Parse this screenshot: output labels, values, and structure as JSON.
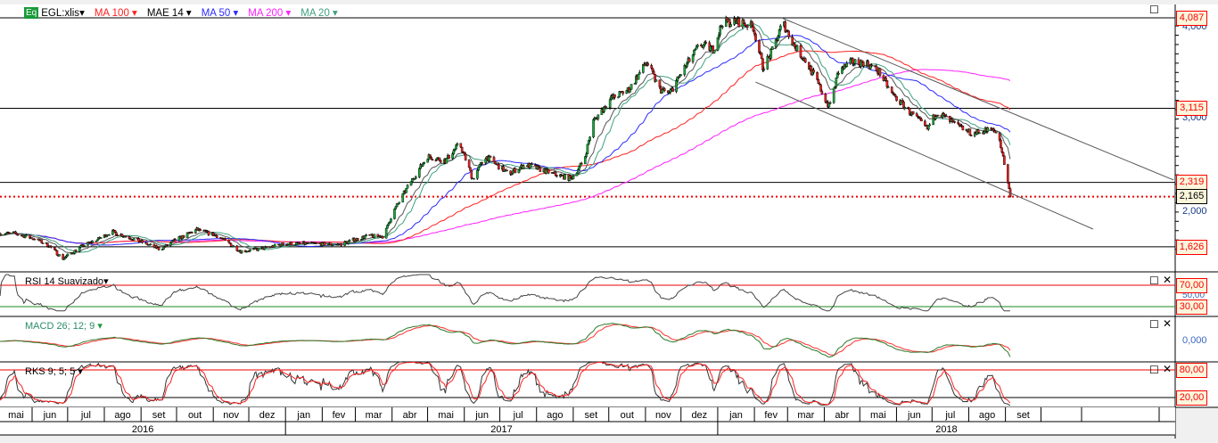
{
  "legend": {
    "symbol_badge": "Eq",
    "symbol": "EGL:xlis",
    "items": [
      {
        "label": "MA 100",
        "color": "#ff2020"
      },
      {
        "label": "MAE 14",
        "color": "#000000"
      },
      {
        "label": "MA 50",
        "color": "#2a2aff"
      },
      {
        "label": "MA 200",
        "color": "#ff20ff"
      },
      {
        "label": "MA 20",
        "color": "#40a080"
      }
    ]
  },
  "panels": {
    "rsi": "RSI 14 Suavizado",
    "macd": "MACD 26; 12; 9",
    "rks": "RKS 9; 5; 5"
  },
  "price_axis": {
    "ticks": [
      "4,000",
      "3,000",
      "2,000"
    ],
    "tick_values": [
      4.0,
      3.0,
      2.0
    ],
    "levels": [
      {
        "label": "4,087",
        "value": 4.087
      },
      {
        "label": "3,115",
        "value": 3.115
      },
      {
        "label": "2,319",
        "value": 2.319
      },
      {
        "label": "1,626",
        "value": 1.626
      }
    ],
    "last": {
      "label": "2,165",
      "value": 2.165
    }
  },
  "rsi_axis": {
    "levels": [
      "70,00",
      "30,00"
    ],
    "mid": "50,00"
  },
  "macd_axis": {
    "zero": "0,000"
  },
  "rks_axis": {
    "levels": [
      "80,00",
      "20,00"
    ]
  },
  "time_axis": {
    "months": [
      "mai",
      "jun",
      "jul",
      "ago",
      "set",
      "out",
      "nov",
      "dez",
      "jan",
      "fev",
      "mar",
      "abr",
      "mai",
      "jun",
      "jul",
      "ago",
      "set",
      "out",
      "nov",
      "dez",
      "jan",
      "fev",
      "mar",
      "abr",
      "mai",
      "jun",
      "jul",
      "ago",
      "set"
    ],
    "years": [
      "2016",
      "2017",
      "2018"
    ]
  },
  "chart_data": {
    "type": "candlestick",
    "symbol": "EGL:xlis",
    "closes": [
      [
        "2016-05-05",
        1.77
      ],
      [
        "2016-05-17",
        1.77
      ],
      [
        "2016-06-04",
        1.71
      ],
      [
        "2016-06-15",
        1.64
      ],
      [
        "2016-06-27",
        1.5
      ],
      [
        "2016-07-14",
        1.64
      ],
      [
        "2016-07-27",
        1.71
      ],
      [
        "2016-08-07",
        1.79
      ],
      [
        "2016-08-26",
        1.71
      ],
      [
        "2016-09-17",
        1.6
      ],
      [
        "2016-10-02",
        1.71
      ],
      [
        "2016-10-18",
        1.81
      ],
      [
        "2016-11-05",
        1.74
      ],
      [
        "2016-11-24",
        1.58
      ],
      [
        "2016-12-09",
        1.6
      ],
      [
        "2017-01-01",
        1.66
      ],
      [
        "2017-01-23",
        1.66
      ],
      [
        "2017-02-15",
        1.65
      ],
      [
        "2017-03-10",
        1.74
      ],
      [
        "2017-03-25",
        1.74
      ],
      [
        "2017-04-01",
        1.98
      ],
      [
        "2017-04-16",
        2.31
      ],
      [
        "2017-05-01",
        2.6
      ],
      [
        "2017-05-16",
        2.55
      ],
      [
        "2017-05-28",
        2.74
      ],
      [
        "2017-06-08",
        2.36
      ],
      [
        "2017-06-19",
        2.6
      ],
      [
        "2017-07-08",
        2.41
      ],
      [
        "2017-07-23",
        2.51
      ],
      [
        "2017-08-15",
        2.41
      ],
      [
        "2017-08-30",
        2.36
      ],
      [
        "2017-09-10",
        2.55
      ],
      [
        "2017-09-18",
        2.98
      ],
      [
        "2017-10-03",
        3.22
      ],
      [
        "2017-10-18",
        3.32
      ],
      [
        "2017-11-02",
        3.61
      ],
      [
        "2017-11-13",
        3.32
      ],
      [
        "2017-11-21",
        3.27
      ],
      [
        "2017-12-02",
        3.51
      ],
      [
        "2017-12-17",
        3.8
      ],
      [
        "2017-12-28",
        3.75
      ],
      [
        "2018-01-05",
        4.04
      ],
      [
        "2018-01-20",
        4.04
      ],
      [
        "2018-01-31",
        3.99
      ],
      [
        "2018-02-08",
        3.56
      ],
      [
        "2018-02-15",
        3.7
      ],
      [
        "2018-02-25",
        4.04
      ],
      [
        "2018-03-06",
        3.8
      ],
      [
        "2018-03-17",
        3.61
      ],
      [
        "2018-03-25",
        3.42
      ],
      [
        "2018-04-05",
        3.13
      ],
      [
        "2018-04-13",
        3.51
      ],
      [
        "2018-04-24",
        3.61
      ],
      [
        "2018-05-05",
        3.61
      ],
      [
        "2018-05-17",
        3.51
      ],
      [
        "2018-05-28",
        3.27
      ],
      [
        "2018-06-12",
        3.08
      ],
      [
        "2018-06-27",
        2.89
      ],
      [
        "2018-07-05",
        3.08
      ],
      [
        "2018-07-20",
        2.94
      ],
      [
        "2018-08-04",
        2.84
      ],
      [
        "2018-08-19",
        2.89
      ],
      [
        "2018-08-26",
        2.84
      ],
      [
        "2018-09-01",
        2.46
      ],
      [
        "2018-09-05",
        2.165
      ]
    ],
    "trendlines": [
      {
        "from": [
          "2018-02-24",
          4.087
        ],
        "to": [
          "2019-01-21",
          2.344
        ]
      },
      {
        "from": [
          "2018-02-02",
          3.397
        ],
        "to": [
          "2018-11-14",
          1.817
        ]
      }
    ],
    "horizontal_levels": [
      4.087,
      3.115,
      2.319,
      1.626
    ],
    "last_price": 2.165,
    "indicators": [
      "MA 100",
      "MAE 14",
      "MA 50",
      "MA 200",
      "MA 20",
      "RSI 14 Suavizado",
      "MACD 26; 12; 9",
      "RKS 9; 5; 5"
    ],
    "ylim": [
      1.45,
      4.25
    ]
  }
}
